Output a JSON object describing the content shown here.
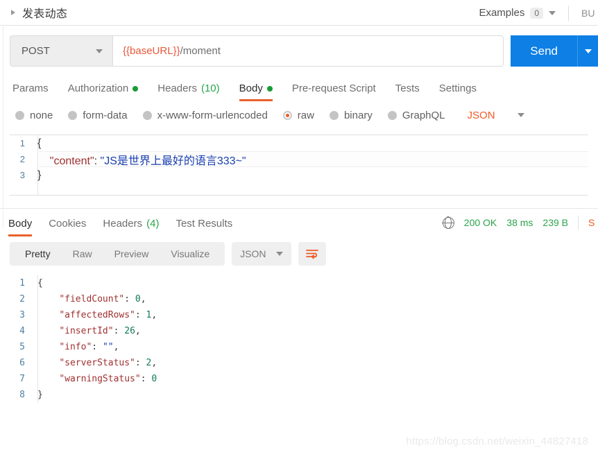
{
  "titlebar": {
    "request_name": "发表动态",
    "examples_label": "Examples",
    "examples_count": "0",
    "build_label": "BU"
  },
  "url_bar": {
    "method": "POST",
    "url_variable": "{{baseURL}}",
    "url_path": "/moment",
    "send_label": "Send"
  },
  "request_tabs": [
    {
      "label": "Params",
      "badge": "",
      "dot": false,
      "active": false
    },
    {
      "label": "Authorization",
      "badge": "",
      "dot": true,
      "active": false
    },
    {
      "label": "Headers",
      "badge": "(10)",
      "dot": false,
      "active": false
    },
    {
      "label": "Body",
      "badge": "",
      "dot": true,
      "active": true
    },
    {
      "label": "Pre-request Script",
      "badge": "",
      "dot": false,
      "active": false
    },
    {
      "label": "Tests",
      "badge": "",
      "dot": false,
      "active": false
    },
    {
      "label": "Settings",
      "badge": "",
      "dot": false,
      "active": false
    }
  ],
  "body_types": {
    "options": [
      {
        "label": "none",
        "selected": false
      },
      {
        "label": "form-data",
        "selected": false
      },
      {
        "label": "x-www-form-urlencoded",
        "selected": false
      },
      {
        "label": "raw",
        "selected": true
      },
      {
        "label": "binary",
        "selected": false
      },
      {
        "label": "GraphQL",
        "selected": false
      }
    ],
    "format_label": "JSON"
  },
  "request_body": {
    "lines": [
      {
        "no": "1",
        "brace": "{",
        "highlight": false
      },
      {
        "no": "2",
        "key": "\"content\"",
        "colon": ": ",
        "value": "\"JS是世界上最好的语言333~\"",
        "indent": "    ",
        "highlight": true
      },
      {
        "no": "3",
        "brace": "}",
        "highlight": false
      }
    ]
  },
  "response_tabs": [
    {
      "label": "Body",
      "badge": "",
      "active": true
    },
    {
      "label": "Cookies",
      "badge": "",
      "active": false
    },
    {
      "label": "Headers",
      "badge": "(4)",
      "active": false
    },
    {
      "label": "Test Results",
      "badge": "",
      "active": false
    }
  ],
  "response_meta": {
    "status": "200 OK",
    "time": "38 ms",
    "size": "239 B",
    "save_label": "Save Response"
  },
  "response_toolbar": {
    "views": [
      {
        "label": "Pretty",
        "active": true
      },
      {
        "label": "Raw",
        "active": false
      },
      {
        "label": "Preview",
        "active": false
      },
      {
        "label": "Visualize",
        "active": false
      }
    ],
    "format_label": "JSON"
  },
  "response_body": {
    "lines": [
      {
        "no": "1",
        "brace": "{"
      },
      {
        "no": "2",
        "indent": "    ",
        "key": "\"fieldCount\"",
        "colon": ": ",
        "num": "0",
        "comma": ","
      },
      {
        "no": "3",
        "indent": "    ",
        "key": "\"affectedRows\"",
        "colon": ": ",
        "num": "1",
        "comma": ","
      },
      {
        "no": "4",
        "indent": "    ",
        "key": "\"insertId\"",
        "colon": ": ",
        "num": "26",
        "comma": ","
      },
      {
        "no": "5",
        "indent": "    ",
        "key": "\"info\"",
        "colon": ": ",
        "str": "\"\"",
        "comma": ","
      },
      {
        "no": "6",
        "indent": "    ",
        "key": "\"serverStatus\"",
        "colon": ": ",
        "num": "2",
        "comma": ","
      },
      {
        "no": "7",
        "indent": "    ",
        "key": "\"warningStatus\"",
        "colon": ": ",
        "num": "0",
        "comma": ""
      },
      {
        "no": "8",
        "brace": "}"
      }
    ]
  },
  "watermark": "https://blog.csdn.net/weixin_44827418",
  "colors": {
    "accent_orange": "#ef5b25",
    "send_blue": "#0d7fe5",
    "status_green": "#2aa44b",
    "json_key": "#a03030",
    "json_string": "#1a3fb0",
    "json_number": "#0f7a52"
  }
}
